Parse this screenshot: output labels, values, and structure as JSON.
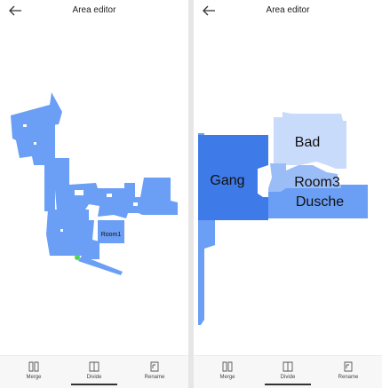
{
  "colors": {
    "room_blue": "#6b9ef5",
    "room_dark": "#3e7ae8",
    "room_light": "#c9dbfb",
    "room_mid": "#9bbdf7",
    "dock_green": "#4fd64f"
  },
  "left_panel": {
    "back_icon": "arrow-left-icon",
    "title": "Area editor",
    "room_label": "Room1"
  },
  "right_panel": {
    "back_icon": "arrow-left-icon",
    "title": "Area editor",
    "rooms": {
      "gang": "Gang",
      "bad": "Bad",
      "room3": "Room3",
      "dusche": "Dusche"
    }
  },
  "toolbar": {
    "merge_label": "Merge",
    "divide_label": "Divide",
    "rename_label": "Rename",
    "merge_icon": "merge-icon",
    "divide_icon": "divide-icon",
    "rename_icon": "rename-icon",
    "active": "divide"
  }
}
